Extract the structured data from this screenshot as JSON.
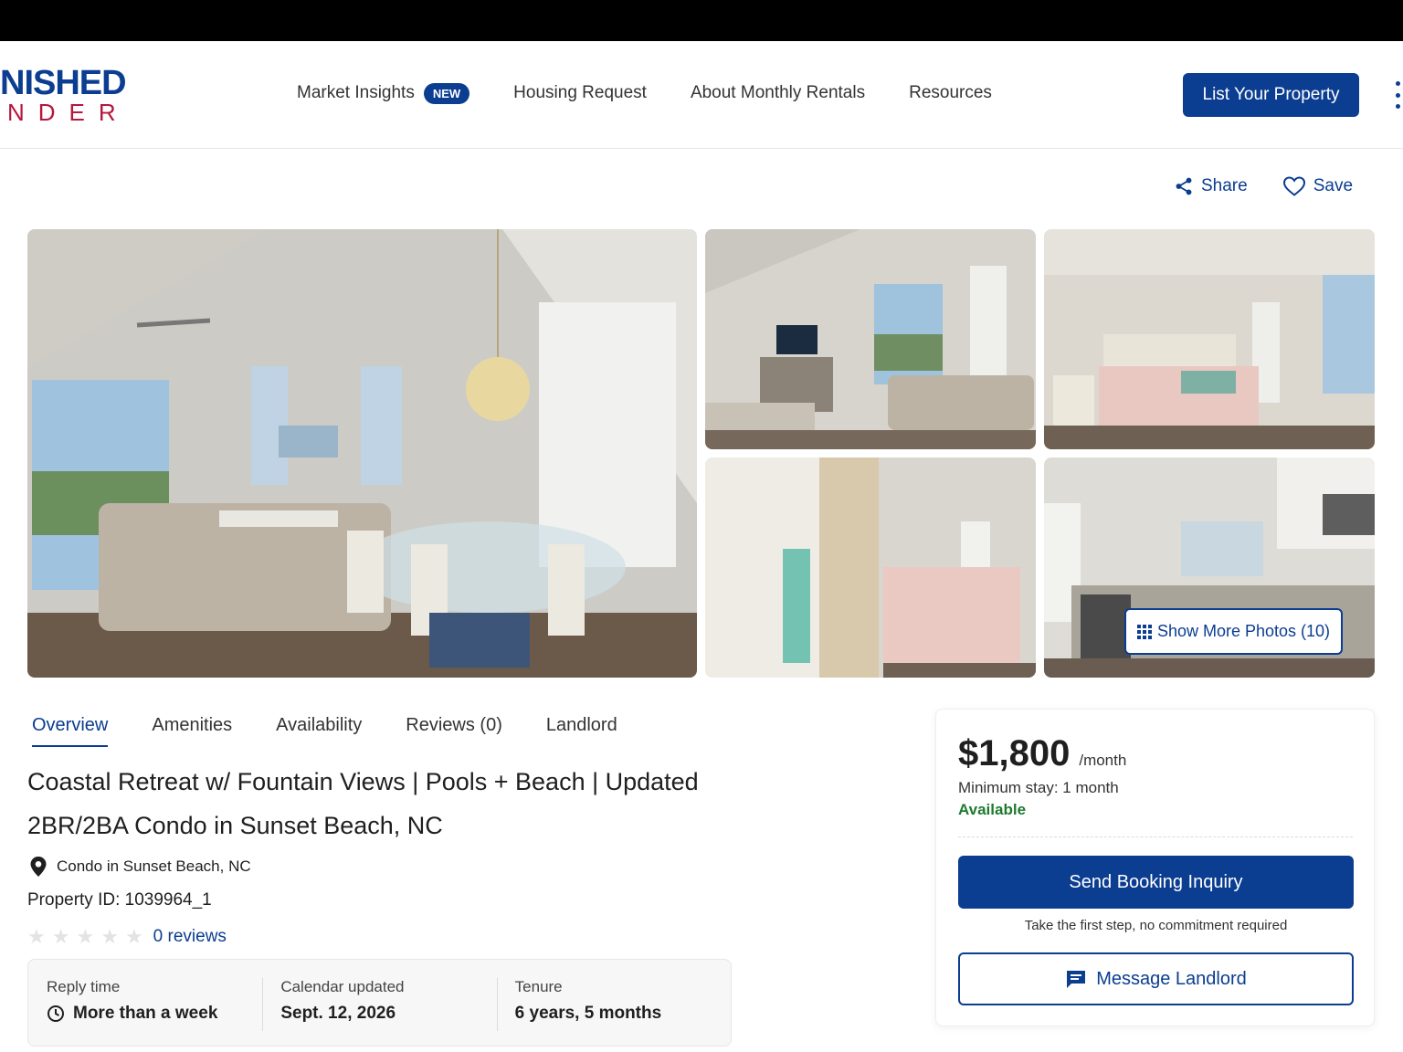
{
  "brand": {
    "logo_top": "NISHED",
    "logo_bottom": "NDER",
    "primary_color": "#0b3d91",
    "accent_color": "#b5183c"
  },
  "nav": {
    "items": [
      {
        "label": "Market Insights",
        "badge": "NEW"
      },
      {
        "label": "Housing Request"
      },
      {
        "label": "About Monthly Rentals"
      },
      {
        "label": "Resources"
      }
    ],
    "cta_label": "List Your Property"
  },
  "actions": {
    "share_label": "Share",
    "save_label": "Save"
  },
  "gallery": {
    "more_photos_label": "Show More Photos (10)"
  },
  "tabs": [
    {
      "label": "Overview",
      "active": true
    },
    {
      "label": "Amenities"
    },
    {
      "label": "Availability"
    },
    {
      "label": "Reviews (0)"
    },
    {
      "label": "Landlord"
    }
  ],
  "listing": {
    "title_line1": "Coastal Retreat w/ Fountain Views | Pools + Beach | Updated",
    "title_line2": "2BR/2BA Condo in Sunset Beach, NC",
    "location": "Condo in Sunset Beach, NC",
    "property_id": "Property ID: 1039964_1",
    "rating_stars": 0,
    "reviews_label": "0 reviews"
  },
  "stats": [
    {
      "label": "Reply time",
      "value": "More than a week",
      "icon": "clock-icon"
    },
    {
      "label": "Calendar updated",
      "value": "Sept. 12, 2026"
    },
    {
      "label": "Tenure",
      "value": "6 years, 5 months"
    }
  ],
  "booking": {
    "price": "$1,800",
    "per": "/month",
    "min_stay": "Minimum stay: 1 month",
    "availability": "Available",
    "availability_color": "#1e7a2f",
    "inquiry_label": "Send Booking Inquiry",
    "note": "Take the first step, no commitment required",
    "message_label": "Message Landlord"
  }
}
